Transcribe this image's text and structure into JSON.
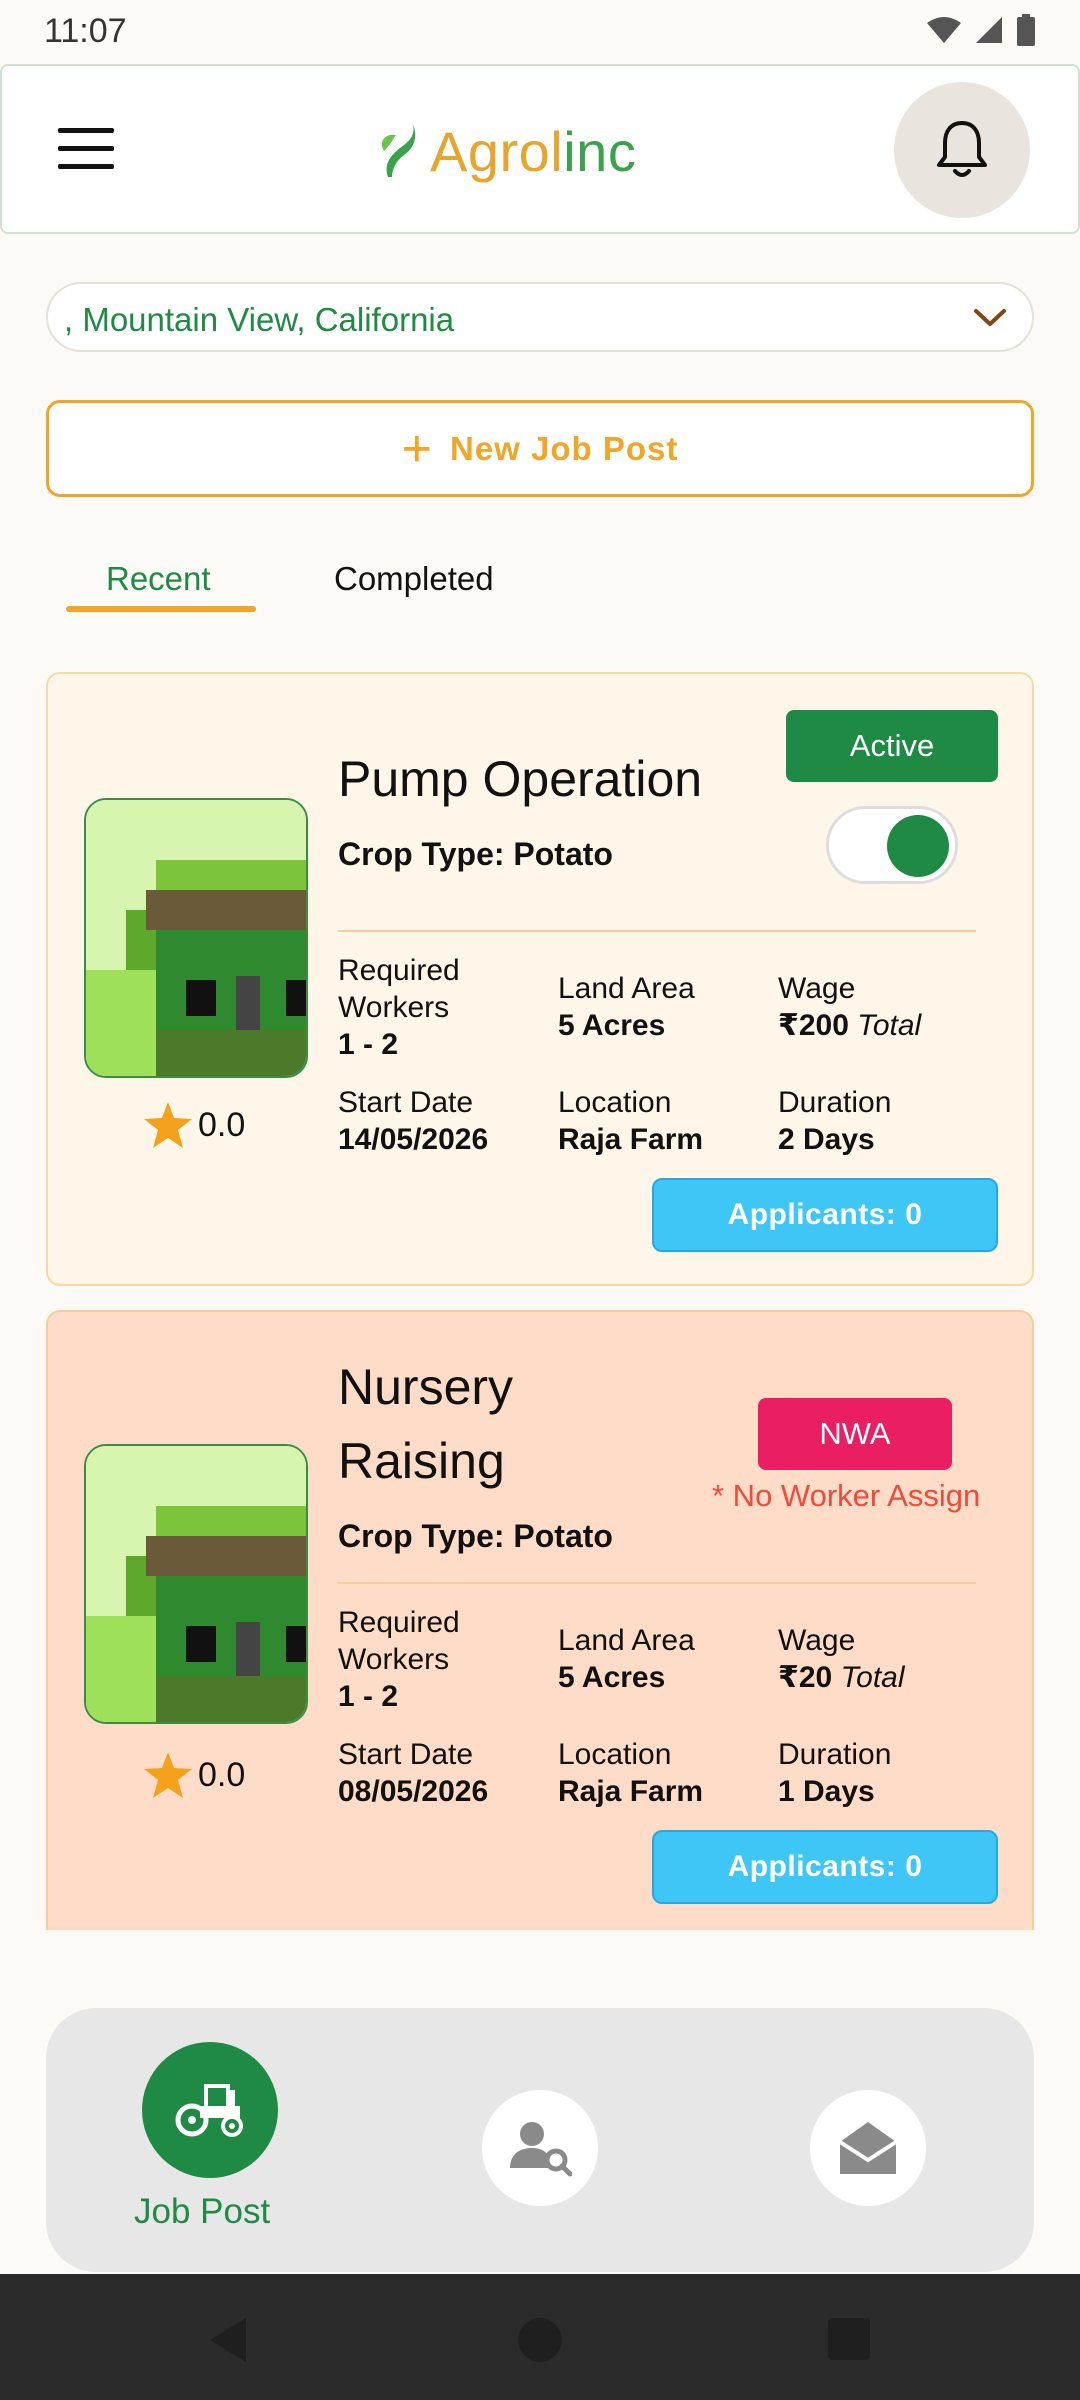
{
  "status_bar": {
    "time": "11:07"
  },
  "app": {
    "logo_main": "Agrol",
    "logo_tail": "inc"
  },
  "location": {
    "value": ", Mountain View, California"
  },
  "actions": {
    "new_job_label": "New Job Post"
  },
  "tabs": [
    {
      "label": "Recent",
      "selected": true
    },
    {
      "label": "Completed",
      "selected": false
    }
  ],
  "labels": {
    "required_workers_line1": "Required",
    "required_workers_line2": "Workers",
    "land_area": "Land Area",
    "wage": "Wage",
    "start_date": "Start Date",
    "location": "Location",
    "duration": "Duration",
    "wage_suffix": "Total"
  },
  "jobs": [
    {
      "title": "Pump Operation",
      "crop": "Crop Type: Potato",
      "status": "Active",
      "toggle_on": true,
      "rating": "0.0",
      "workers": "1 - 2",
      "land_area": "5 Acres",
      "wage": "₹200",
      "start_date": "14/05/2026",
      "location": "Raja Farm",
      "duration": "2 Days",
      "applicants": "Applicants: 0"
    },
    {
      "title_line1": "Nursery",
      "title_line2": "Raising",
      "crop": "Crop Type: Potato",
      "status": "NWA",
      "status_note": "* No Worker Assign",
      "rating": "0.0",
      "workers": "1 - 2",
      "land_area": "5 Acres",
      "wage": "₹20",
      "start_date": "08/05/2026",
      "location": "Raja Farm",
      "duration": "1 Days",
      "applicants": "Applicants: 0"
    }
  ],
  "bottom_nav": {
    "active_label": "Job Post"
  },
  "colors": {
    "primary_green": "#1f8a43",
    "accent_orange": "#f1a62a",
    "nwa_pink": "#e91e63",
    "applicants_blue": "#3ec6f7"
  },
  "icons": [
    "menu-icon",
    "bell-icon",
    "chevron-down-icon",
    "plus-icon",
    "star-icon",
    "tractor-icon",
    "user-search-icon",
    "mail-open-icon"
  ]
}
